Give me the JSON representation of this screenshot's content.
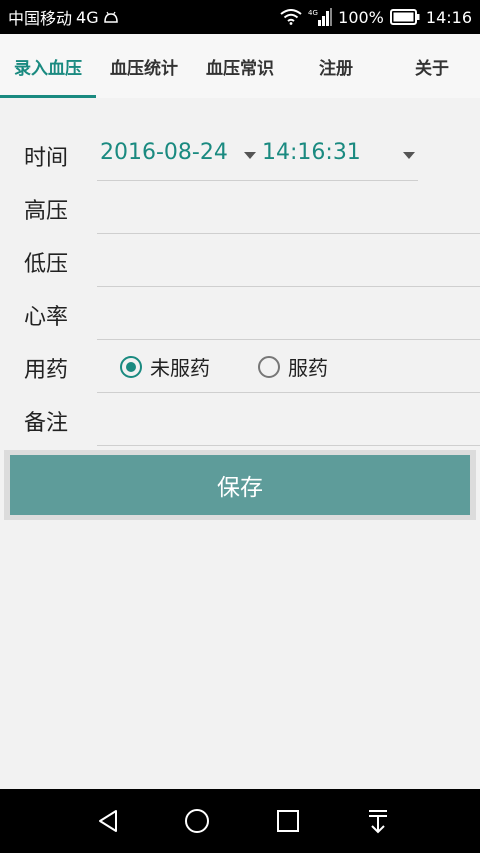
{
  "status_bar": {
    "carrier": "中国移动",
    "network": "4G",
    "signal_label": "4G",
    "battery": "100%",
    "time": "14:16"
  },
  "tabs": [
    {
      "label": "录入血压",
      "active": true
    },
    {
      "label": "血压统计",
      "active": false
    },
    {
      "label": "血压常识",
      "active": false
    },
    {
      "label": "注册",
      "active": false
    },
    {
      "label": "关于",
      "active": false
    }
  ],
  "form": {
    "time_label": "时间",
    "date_value": "2016-08-24",
    "time_value": "14:16:31",
    "high_label": "高压",
    "high_value": "",
    "low_label": "低压",
    "low_value": "",
    "heart_label": "心率",
    "heart_value": "",
    "med_label": "用药",
    "med_options": [
      {
        "label": "未服药",
        "checked": true
      },
      {
        "label": "服药",
        "checked": false
      }
    ],
    "note_label": "备注",
    "note_value": ""
  },
  "save_label": "保存",
  "colors": {
    "accent": "#1a8a80",
    "save_button": "#5e9c9a"
  },
  "icons": {
    "nav": [
      "back-icon",
      "home-icon",
      "recent-apps-icon",
      "notification-down-icon"
    ]
  }
}
